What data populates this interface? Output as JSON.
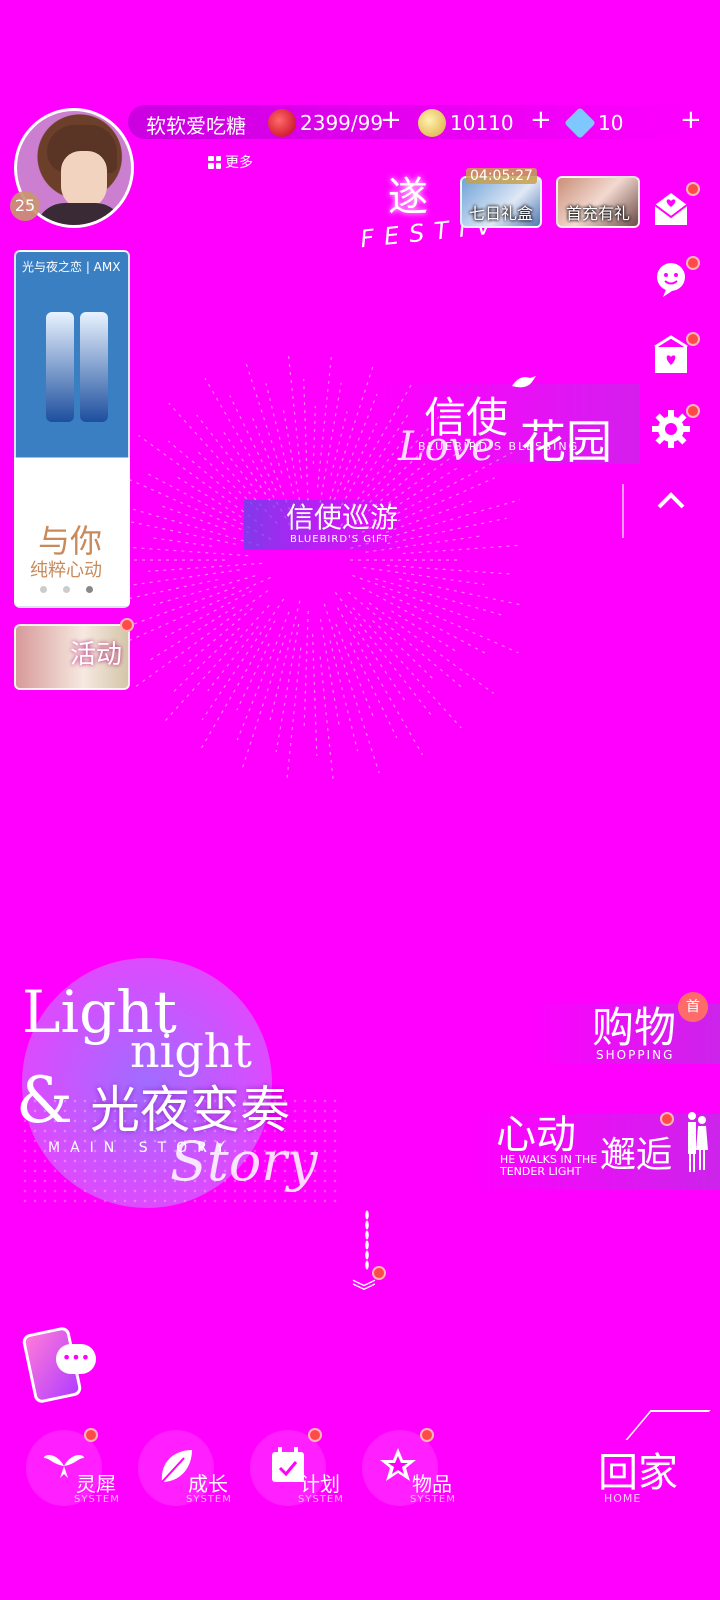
{
  "player": {
    "name": "软软爱吃糖",
    "level": "25",
    "more_label": "更多"
  },
  "resources": {
    "stamina": "2399/99",
    "coins": "10110",
    "diamonds": "10",
    "plus": "+"
  },
  "festival": {
    "char": "遂",
    "word": "FESTIV"
  },
  "promos": {
    "timer": "04:05:27",
    "seven_day_gift": "七日礼盒",
    "first_charge": "首充有礼"
  },
  "side_icons": [
    "mail-icon",
    "chat-icon",
    "gift-box-icon",
    "settings-icon",
    "collapse-icon"
  ],
  "banners": {
    "ad_brand": "光与夜之恋 | AMX",
    "ad_title": "与你",
    "ad_sub": "纯粹心动",
    "activity": "活动"
  },
  "garden": {
    "title_a": "信使",
    "title_b": "花园",
    "english": "BLUEBIRD'S BLESSING",
    "script": "Love"
  },
  "cruise": {
    "title": "信使巡游",
    "english": "BLUEBIRD'S GIFT"
  },
  "story": {
    "light": "Light",
    "night": "night",
    "amp": "&",
    "cn": "光夜变奏",
    "english": "MAIN STORY",
    "script": "Story"
  },
  "shopping": {
    "title": "购物",
    "english": "SHOPPING",
    "badge": "首"
  },
  "encounter": {
    "title_a": "心动",
    "title_b": "邂逅",
    "english": "HE WALKS IN THE TENDER LIGHT"
  },
  "scroll_hint": "︾",
  "nav": [
    {
      "label": "灵犀",
      "sub": "SYSTEM"
    },
    {
      "label": "成长",
      "sub": "SYSTEM"
    },
    {
      "label": "计划",
      "sub": "SYSTEM"
    },
    {
      "label": "物品",
      "sub": "SYSTEM"
    }
  ],
  "home": {
    "label": "回家",
    "english": "HOME"
  },
  "colors": {
    "background": "#ff00ff",
    "notification": "#ff4a4a"
  }
}
